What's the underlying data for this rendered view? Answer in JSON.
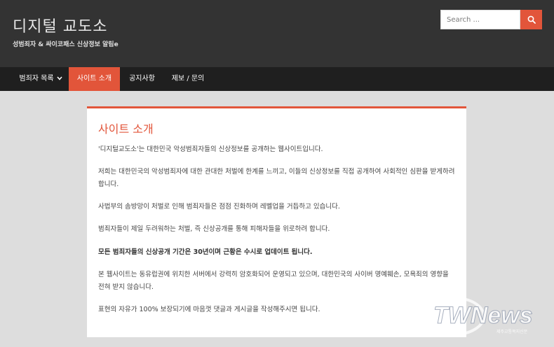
{
  "site": {
    "title": "디지털 교도소",
    "description": "성범죄자 & 싸이코패스 신상정보 알림e"
  },
  "search": {
    "placeholder": "Search ..."
  },
  "nav": {
    "items": [
      {
        "label": "범죄자 목록"
      },
      {
        "label": "사이트 소개"
      },
      {
        "label": "공지사항"
      },
      {
        "label": "제보 / 문의"
      }
    ]
  },
  "page": {
    "title": "사이트 소개",
    "paragraphs": [
      "'디지털교도소'는 대한민국 악성범죄자들의 신상정보를 공개하는 웹사이트입니다.",
      "저희는 대한민국의 악성범죄자에 대한 관대한 처벌에 한계를 느끼고, 이들의 신상정보를 직접 공개하여 사회적인 심판을 받게하려 합니다.",
      "사법부의 솜방망이 처벌로 인해 범죄자들은 점점 진화하며 레벨업을 거듭하고 있습니다.",
      "범죄자들이 제일 두려워하는 처벌, 즉 신상공개를 통해 피해자들을 위로하려 합니다.",
      "모든 범죄자들의 신상공개 기간은 30년이며 근황은 수시로 업데이트 됩니다.",
      "본 웹사이트는 동유럽권에 위치한 서버에서 강력히 암호화되어 운영되고 있으며, 대한민국의 사이버 명예훼손, 모욕죄의 영향을 전혀 받지 않습니다.",
      "표현의 자유가 100% 보장되기에 마음껏 댓글과 게시글을 작성해주시면 됩니다."
    ]
  },
  "watermark": {
    "logo": "TWNews",
    "tagline": "제주교통복지신문"
  },
  "colors": {
    "accent": "#e2553a",
    "header_bg": "#333333",
    "nav_bg": "#1f1f1f",
    "page_bg": "#dddddd"
  }
}
